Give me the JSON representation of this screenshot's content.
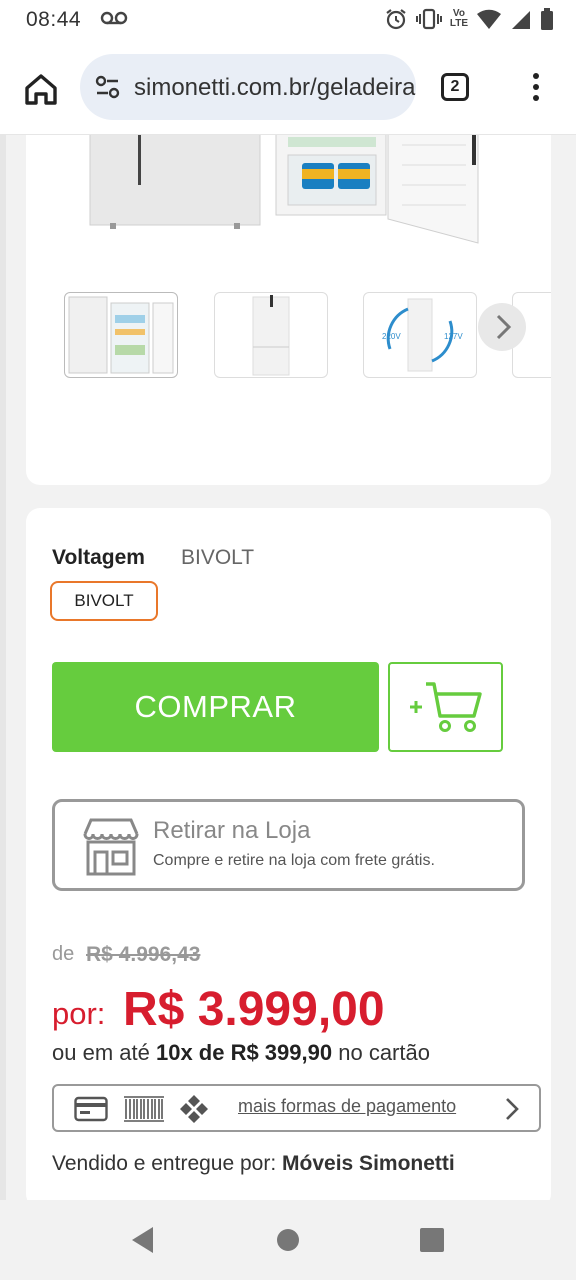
{
  "status_bar": {
    "time": "08:44",
    "icons": [
      "voicemail-icon",
      "alarm-icon",
      "vibrate-icon",
      "volte-icon",
      "wifi-icon",
      "signal-icon",
      "battery-icon"
    ],
    "volte_top": "Vo",
    "volte_bottom": "LTE"
  },
  "browser": {
    "url": "simonetti.com.br/geladeira",
    "tab_count": "2"
  },
  "product": {
    "voltage_label": "Voltagem",
    "voltage_value": "BIVOLT",
    "voltage_option": "BIVOLT",
    "buy_label": "COMPRAR",
    "pickup_title": "Retirar na Loja",
    "pickup_subtitle": "Compre e retire na loja com frete grátis.",
    "old_price_prefix": "de",
    "old_price": "R$ 4.996,43",
    "price_prefix": "por:",
    "price": "R$ 3.999,00",
    "installment_prefix": "ou em até",
    "installment_plan": "10x de R$ 399,90",
    "installment_suffix": "no cartão",
    "more_payment_label": "mais formas de pagamento",
    "seller_prefix": "Vendido e entregue por:",
    "seller_name": "Móveis Simonetti",
    "thumb_labels": {
      "left": "220V",
      "right": "127V"
    }
  },
  "colors": {
    "accent_green": "#66cc3e",
    "price_red": "#d71d2e",
    "chip_orange": "#e9772a"
  }
}
